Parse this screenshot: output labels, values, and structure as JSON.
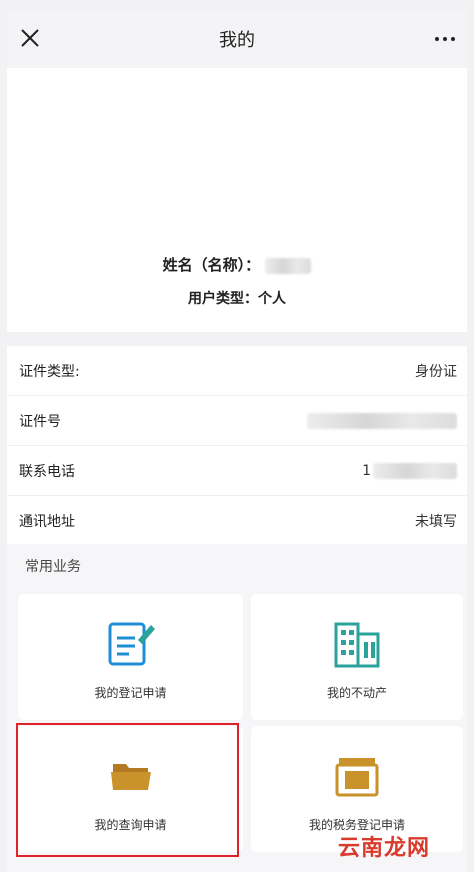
{
  "header": {
    "title": "我的"
  },
  "profile": {
    "name_label": "姓名（名称）：",
    "user_type": "用户类型：个人"
  },
  "info": [
    {
      "label": "证件类型:",
      "value": "身份证"
    },
    {
      "label": "证件号",
      "value": ""
    },
    {
      "label": "联系电话",
      "value": "1"
    },
    {
      "label": "通讯地址",
      "value": "未填写"
    }
  ],
  "services": {
    "heading": "常用业务",
    "items": [
      {
        "label": "我的登记申请",
        "icon": "document-edit-icon"
      },
      {
        "label": "我的不动产",
        "icon": "building-icon"
      },
      {
        "label": "我的查询申请",
        "icon": "folder-icon"
      },
      {
        "label": "我的税务登记申请",
        "icon": "tax-box-icon"
      }
    ]
  },
  "watermark": "云南龙网",
  "colors": {
    "teal": "#2aa39a",
    "blue": "#1e8fd6",
    "gold": "#c9922a",
    "highlight": "#e0202a"
  }
}
